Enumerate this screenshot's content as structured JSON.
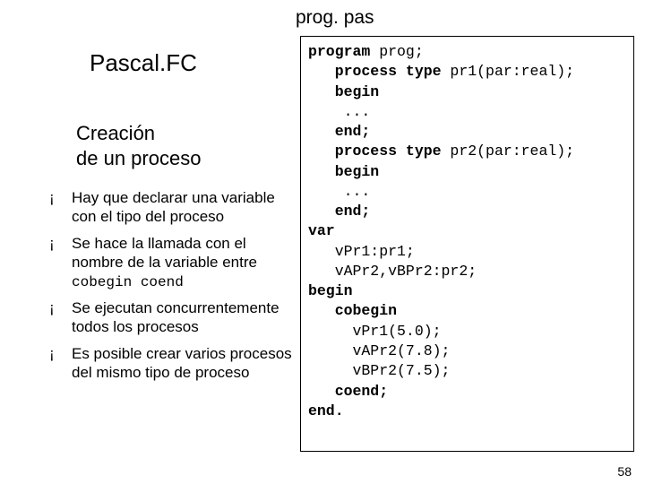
{
  "file_label": "prog. pas",
  "title": "Pascal.FC",
  "subtitle_line1": "Creación",
  "subtitle_line2": "de un proceso",
  "bullet_marker": "¡",
  "bullets": [
    {
      "pre": "Hay que declarar una variable con el tipo del proceso",
      "code": "",
      "post": ""
    },
    {
      "pre": "Se hace la llamada con el nombre de la variable entre ",
      "code": "cobegin coend",
      "post": ""
    },
    {
      "pre": "Se ejecutan concurrentemente todos los procesos",
      "code": "",
      "post": ""
    },
    {
      "pre": "Es posible crear varios procesos del mismo tipo de proceso",
      "code": "",
      "post": ""
    }
  ],
  "code": {
    "l01a": "program",
    "l01b": " prog;",
    "l02a": "   process type",
    "l02b": " pr1(par:real);",
    "l03a": "   begin",
    "l04": "    ...",
    "l05a": "   end;",
    "l06a": "   process type",
    "l06b": " pr2(par:real);",
    "l07a": "   begin",
    "l08": "    ...",
    "l09a": "   end;",
    "l10a": "var",
    "l11": "   vPr1:pr1;",
    "l12": "   vAPr2,vBPr2:pr2;",
    "l13a": "begin",
    "l14a": "   cobegin",
    "l15": "     vPr1(5.0);",
    "l16": "     vAPr2(7.8);",
    "l17": "     vBPr2(7.5);",
    "l18a": "   coend;",
    "l19a": "end."
  },
  "page_number": "58"
}
